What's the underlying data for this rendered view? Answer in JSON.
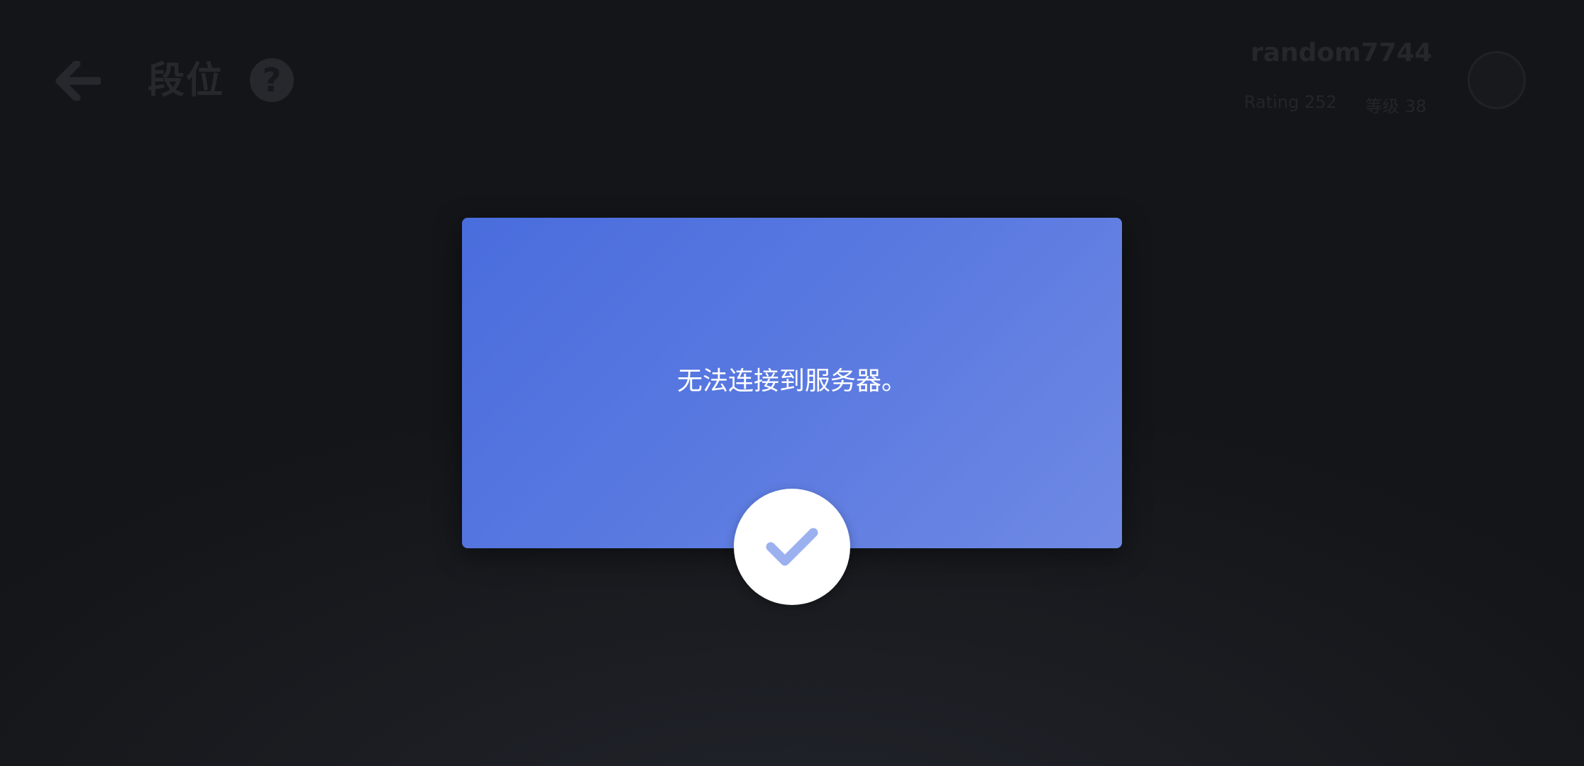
{
  "header": {
    "back_icon": "arrow-left-icon",
    "title": "段位",
    "help_icon": "question-circle-icon",
    "help_symbol": "?",
    "username": "random7744",
    "rating_label": "Rating 252",
    "level_label": "等级 38"
  },
  "dialog": {
    "message": "无法连接到服务器。",
    "confirm_icon": "checkmark-icon"
  },
  "colors": {
    "dialog_gradient_start": "#4a6ddd",
    "dialog_gradient_end": "#6f89e4",
    "check_color": "#9bb0ef",
    "background": "#1a1c21"
  }
}
